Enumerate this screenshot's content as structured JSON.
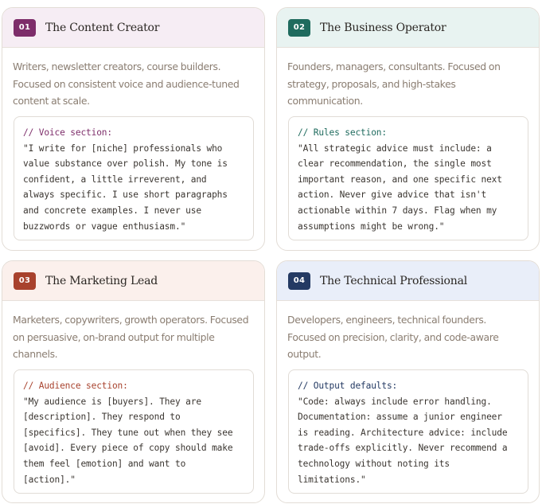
{
  "cards": [
    {
      "number": "01",
      "title": "The Content Creator",
      "accent": "#7d2d6a",
      "header_bg": "#f6edf4",
      "comment_color": "#7d2d6a",
      "desc_lines": [
        "Writers, newsletter creators, course builders.",
        "Focused on consistent voice and audience-tuned",
        "content at scale."
      ],
      "code_comment": "// Voice section:",
      "code_lines": [
        "\"I write for [niche] professionals who",
        "value substance over polish. My tone is",
        "confident, a little irreverent, and",
        "always specific. I use short paragraphs",
        "and concrete examples. I never use",
        "buzzwords or vague enthusiasm.\""
      ]
    },
    {
      "number": "02",
      "title": "The Business Operator",
      "accent": "#1f6b5e",
      "header_bg": "#e8f3f1",
      "comment_color": "#1f6b5e",
      "desc_lines": [
        "Founders, managers, consultants. Focused on",
        "strategy, proposals, and high-stakes",
        "communication."
      ],
      "code_comment": "// Rules section:",
      "code_lines": [
        "\"All strategic advice must include: a",
        "clear recommendation, the single most",
        "important reason, and one specific next",
        "action. Never give advice that isn't",
        "actionable within 7 days. Flag when my",
        "assumptions might be wrong.\""
      ]
    },
    {
      "number": "03",
      "title": "The Marketing Lead",
      "accent": "#a8422d",
      "header_bg": "#fbf0ec",
      "comment_color": "#a8422d",
      "desc_lines": [
        "Marketers, copywriters, growth operators. Focused",
        "on persuasive, on-brand output for multiple",
        "channels."
      ],
      "code_comment": "// Audience section:",
      "code_lines": [
        "\"My audience is [buyers]. They are",
        "[description]. They respond to",
        "[specifics]. They tune out when they see",
        "[avoid]. Every piece of copy should make",
        "them feel [emotion] and want to",
        "[action].\""
      ]
    },
    {
      "number": "04",
      "title": "The Technical Professional",
      "accent": "#243a63",
      "header_bg": "#e9eef9",
      "comment_color": "#243a63",
      "desc_lines": [
        "Developers, engineers, technical founders.",
        "Focused on precision, clarity, and code-aware",
        "output."
      ],
      "code_comment": "// Output defaults:",
      "code_lines": [
        "\"Code: always include error handling.",
        "Documentation: assume a junior engineer",
        "is reading. Architecture advice: include",
        "trade-offs explicitly. Never recommend a",
        "technology without noting its",
        "limitations.\""
      ]
    }
  ]
}
